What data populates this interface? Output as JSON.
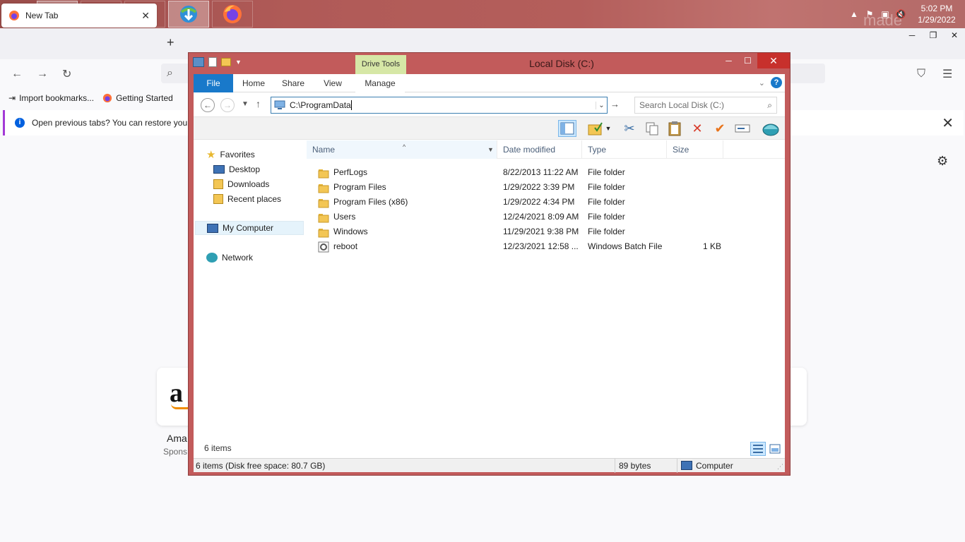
{
  "taskbar": {
    "apps": [
      "file-explorer",
      "chrome",
      "store",
      "internet-download-manager",
      "firefox"
    ],
    "clock_time": "5:02 PM",
    "clock_date": "1/29/2022",
    "watermark": "made"
  },
  "firefox": {
    "tab_title": "New Tab",
    "bookmarks": [
      "Import bookmarks...",
      "Getting Started"
    ],
    "notice_text": "Open previous tabs? You can restore your",
    "tile_logo": "a",
    "tile_title": "Ama",
    "tile_sub": "Spons"
  },
  "explorer": {
    "title": "Local Disk (C:)",
    "drive_tools": "Drive Tools",
    "tabs": {
      "file": "File",
      "home": "Home",
      "share": "Share",
      "view": "View",
      "manage": "Manage"
    },
    "address": "C:\\ProgramData",
    "search_placeholder": "Search Local Disk (C:)",
    "nav": {
      "favorites": "Favorites",
      "desktop": "Desktop",
      "downloads": "Downloads",
      "recent": "Recent places",
      "computer": "My Computer",
      "network": "Network"
    },
    "columns": {
      "name": "Name",
      "date": "Date modified",
      "type": "Type",
      "size": "Size"
    },
    "files": [
      {
        "name": "PerfLogs",
        "date": "8/22/2013 11:22 AM",
        "type": "File folder",
        "size": "",
        "icon": "folder"
      },
      {
        "name": "Program Files",
        "date": "1/29/2022 3:39 PM",
        "type": "File folder",
        "size": "",
        "icon": "folder"
      },
      {
        "name": "Program Files (x86)",
        "date": "1/29/2022 4:34 PM",
        "type": "File folder",
        "size": "",
        "icon": "folder"
      },
      {
        "name": "Users",
        "date": "12/24/2021 8:09 AM",
        "type": "File folder",
        "size": "",
        "icon": "folder"
      },
      {
        "name": "Windows",
        "date": "11/29/2021 9:38 PM",
        "type": "File folder",
        "size": "",
        "icon": "folder"
      },
      {
        "name": "reboot",
        "date": "12/23/2021 12:58 ...",
        "type": "Windows Batch File",
        "size": "1 KB",
        "icon": "batch"
      }
    ],
    "item_count": "6 items",
    "status_left": "6 items (Disk free space: 80.7 GB)",
    "status_size": "89 bytes",
    "status_location": "Computer",
    "colors": {
      "file_tab": "#1979ca",
      "drive_tools": "#d6e7a6",
      "frame": "#c25b5b",
      "close": "#c7302c"
    }
  }
}
